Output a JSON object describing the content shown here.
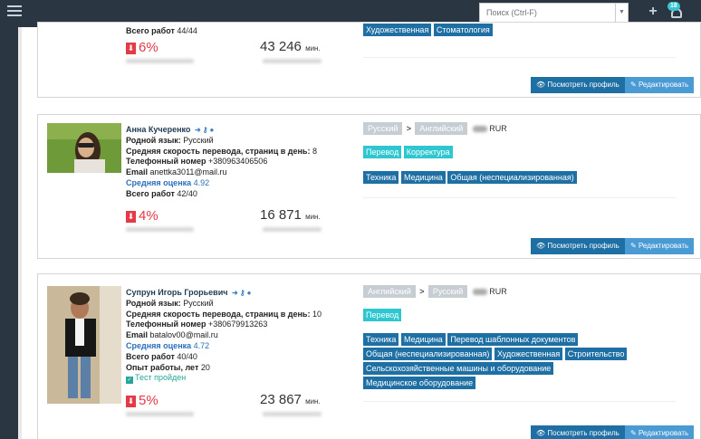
{
  "topbar": {
    "search_placeholder": "Поиск (Ctrl-F)",
    "notification_count": "18"
  },
  "cards": [
    {
      "total_label": "Всего работ",
      "total": "44/44",
      "percent": "6%",
      "minutes": "43 246",
      "minutes_unit": "мин.",
      "tags_navy": [
        "Художественная",
        "Стоматология"
      ],
      "view_label": "Посмотреть профиль",
      "edit_label": "Редактировать"
    },
    {
      "name": "Анна Кучеренко",
      "native_label": "Родной язык:",
      "native": "Русский",
      "speed_label": "Средняя скорость перевода, страниц в день:",
      "speed": "8",
      "phone_label": "Телефонный номер",
      "phone": "+380963406506",
      "email_label": "Email",
      "email": "anettka3011@mail.ru",
      "rating_label": "Средняя оценка",
      "rating": "4.92",
      "total_label": "Всего работ",
      "total": "42/40",
      "percent": "4%",
      "minutes": "16 871",
      "minutes_unit": "мин.",
      "lang_from": "Русский",
      "lang_to": "Английский",
      "currency": "RUR",
      "tags_cyan": [
        "Перевод",
        "Корректура"
      ],
      "tags_navy": [
        "Техника",
        "Медицина",
        "Общая (неспециализированная)"
      ],
      "view_label": "Посмотреть профиль",
      "edit_label": "Редактировать"
    },
    {
      "name": "Супрун Игорь Грорьевич",
      "native_label": "Родной язык:",
      "native": "Русский",
      "speed_label": "Средняя скорость перевода, страниц в день:",
      "speed": "10",
      "phone_label": "Телефонный номер",
      "phone": "+380679913263",
      "email_label": "Email",
      "email": "batalov00@mail.ru",
      "rating_label": "Средняя оценка",
      "rating": "4.72",
      "total_label": "Всего работ",
      "total": "40/40",
      "experience_label": "Опыт работы, лет",
      "experience": "20",
      "test_label": "Тест пройден",
      "percent": "5%",
      "minutes": "23 867",
      "minutes_unit": "мин.",
      "lang_from": "Английский",
      "lang_to": "Русский",
      "currency": "RUR",
      "tags_cyan": [
        "Перевод"
      ],
      "tags_navy": [
        "Техника",
        "Медицина",
        "Перевод шаблонных документов",
        "Общая (неспециализированная)",
        "Художественная",
        "Строительство",
        "Сельскохозяйственные машины и оборудование",
        "Медицинское оборудование"
      ],
      "view_label": "Посмотреть профиль",
      "edit_label": "Редактировать"
    }
  ],
  "colors": {
    "accent_cyan": "#2ec7d0",
    "accent_navy": "#1e6fa3",
    "danger": "#e43a45",
    "topbar": "#2b3643"
  }
}
